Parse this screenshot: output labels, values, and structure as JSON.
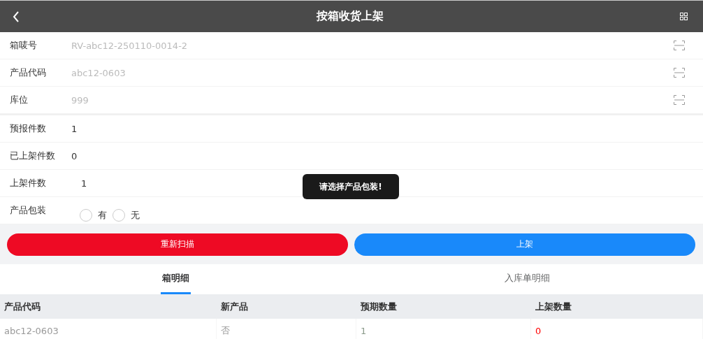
{
  "header": {
    "title": "按箱收货上架"
  },
  "scan_fields": [
    {
      "label": "箱唛号",
      "value": "RV-abc12-250110-0014-2"
    },
    {
      "label": "产品代码",
      "value": "abc12-0603"
    },
    {
      "label": "库位",
      "value": "999"
    }
  ],
  "info_rows": [
    {
      "kind": "text",
      "label": "预报件数",
      "value": "1"
    },
    {
      "kind": "text",
      "label": "已上架件数",
      "value": "0"
    },
    {
      "kind": "input",
      "label": "上架件数",
      "value": "1"
    },
    {
      "kind": "radio",
      "label": "产品包装",
      "options": [
        {
          "label": "有",
          "selected": false
        },
        {
          "label": "无",
          "selected": false
        }
      ]
    }
  ],
  "toast": "请选择产品包装!",
  "buttons": [
    {
      "label": "重新扫描",
      "kind": "danger"
    },
    {
      "label": "上架",
      "kind": "primary"
    }
  ],
  "tabs": [
    {
      "label": "箱明细",
      "selected": true
    },
    {
      "label": "入库单明细",
      "selected": false
    }
  ],
  "table": {
    "columns": [
      "产品代码",
      "新产品",
      "预期数量",
      "上架数量"
    ],
    "rows": [
      [
        {
          "text": "abc12-0603",
          "color": "#999999"
        },
        {
          "text": "否",
          "color": "#999999"
        },
        {
          "text": "1",
          "color": "#8a9a8a"
        },
        {
          "text": "0",
          "color": "#ff0000"
        }
      ]
    ]
  }
}
